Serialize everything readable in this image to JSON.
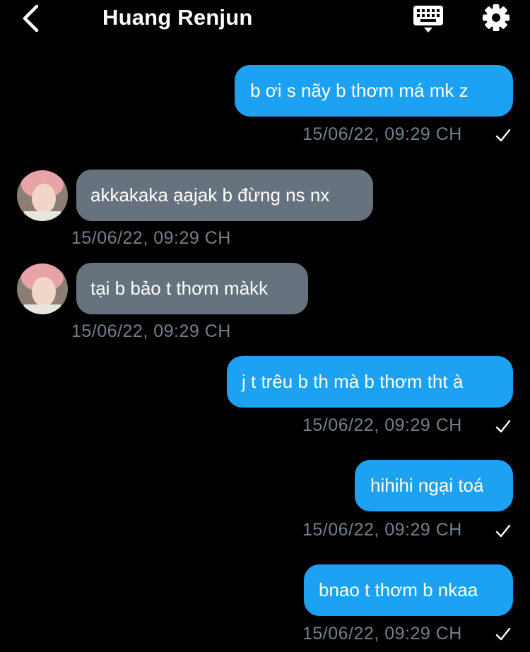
{
  "header": {
    "title": "Huang Renjun"
  },
  "messages": [
    {
      "direction": "outgoing",
      "text": "b ơi s nãy b thơm má mk z",
      "timestamp": "15/06/22, 09:29 CH"
    },
    {
      "direction": "incoming",
      "text": "akkakaka ạajak b đừng ns nx",
      "timestamp": "15/06/22, 09:29 CH"
    },
    {
      "direction": "incoming",
      "text": "tại b bảo t thơm màkk",
      "timestamp": "15/06/22, 09:29 CH"
    },
    {
      "direction": "outgoing",
      "text": "j t trêu b th mà b thơm tht à",
      "timestamp": "15/06/22, 09:29 CH"
    },
    {
      "direction": "outgoing",
      "text": "hihihi ngại toá",
      "timestamp": "15/06/22, 09:29 CH"
    },
    {
      "direction": "outgoing",
      "text": "bnao t thơm b nkaa",
      "timestamp": "15/06/22, 09:29 CH"
    }
  ],
  "icons": {
    "back": "chevron-left-icon",
    "keyboard": "keyboard-icon",
    "settings": "gear-icon",
    "read_receipt": "checkmark-icon"
  },
  "colors": {
    "background": "#000000",
    "outgoing_bubble": "#1da1f2",
    "incoming_bubble": "#66737f",
    "timestamp": "#72808c",
    "text": "#ffffff"
  }
}
